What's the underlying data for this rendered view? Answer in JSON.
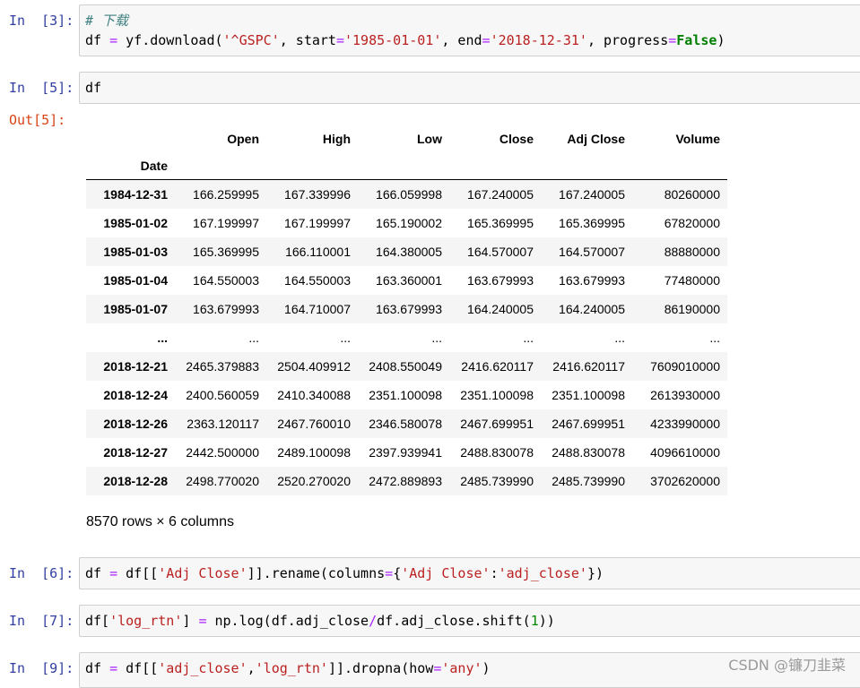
{
  "cells": [
    {
      "prompt": "In  [3]:",
      "lines": [
        [
          {
            "t": "# 下载",
            "c": "cm-comment"
          }
        ],
        [
          {
            "t": "df ",
            "c": "cm-var"
          },
          {
            "t": "=",
            "c": "cm-op"
          },
          {
            "t": " yf.download(",
            "c": "cm-var"
          },
          {
            "t": "'^GSPC'",
            "c": "cm-string"
          },
          {
            "t": ", start",
            "c": "cm-var"
          },
          {
            "t": "=",
            "c": "cm-op"
          },
          {
            "t": "'1985-01-01'",
            "c": "cm-string"
          },
          {
            "t": ", end",
            "c": "cm-var"
          },
          {
            "t": "=",
            "c": "cm-op"
          },
          {
            "t": "'2018-12-31'",
            "c": "cm-string"
          },
          {
            "t": ", progress",
            "c": "cm-var"
          },
          {
            "t": "=",
            "c": "cm-op"
          },
          {
            "t": "False",
            "c": "cm-keyword"
          },
          {
            "t": ")",
            "c": "cm-var"
          }
        ]
      ]
    },
    {
      "prompt": "In  [5]:",
      "lines": [
        [
          {
            "t": "df",
            "c": "cm-var"
          }
        ]
      ]
    },
    {
      "prompt": "In  [6]:",
      "lines": [
        [
          {
            "t": "df ",
            "c": "cm-var"
          },
          {
            "t": "=",
            "c": "cm-op"
          },
          {
            "t": " df[[",
            "c": "cm-var"
          },
          {
            "t": "'Adj Close'",
            "c": "cm-string"
          },
          {
            "t": "]].rename(columns",
            "c": "cm-var"
          },
          {
            "t": "=",
            "c": "cm-op"
          },
          {
            "t": "{",
            "c": "cm-var"
          },
          {
            "t": "'Adj Close'",
            "c": "cm-string"
          },
          {
            "t": ":",
            "c": "cm-var"
          },
          {
            "t": "'adj_close'",
            "c": "cm-string"
          },
          {
            "t": "})",
            "c": "cm-var"
          }
        ]
      ]
    },
    {
      "prompt": "In  [7]:",
      "lines": [
        [
          {
            "t": "df[",
            "c": "cm-var"
          },
          {
            "t": "'log_rtn'",
            "c": "cm-string"
          },
          {
            "t": "] ",
            "c": "cm-var"
          },
          {
            "t": "=",
            "c": "cm-op"
          },
          {
            "t": " np.log(df.adj_close",
            "c": "cm-var"
          },
          {
            "t": "/",
            "c": "cm-op"
          },
          {
            "t": "df.adj_close.shift(",
            "c": "cm-var"
          },
          {
            "t": "1",
            "c": "cm-number"
          },
          {
            "t": "))",
            "c": "cm-var"
          }
        ]
      ]
    },
    {
      "prompt": "In  [9]:",
      "lines": [
        [
          {
            "t": "df ",
            "c": "cm-var"
          },
          {
            "t": "=",
            "c": "cm-op"
          },
          {
            "t": " df[[",
            "c": "cm-var"
          },
          {
            "t": "'adj_close'",
            "c": "cm-string"
          },
          {
            "t": ",",
            "c": "cm-var"
          },
          {
            "t": "'log_rtn'",
            "c": "cm-string"
          },
          {
            "t": "]].dropna(how",
            "c": "cm-var"
          },
          {
            "t": "=",
            "c": "cm-op"
          },
          {
            "t": "'any'",
            "c": "cm-string"
          },
          {
            "t": ")",
            "c": "cm-var"
          }
        ]
      ]
    }
  ],
  "output": {
    "prompt": "Out[5]:",
    "columns": [
      "Open",
      "High",
      "Low",
      "Close",
      "Adj Close",
      "Volume"
    ],
    "index_name": "Date",
    "rows": [
      [
        "1984-12-31",
        "166.259995",
        "167.339996",
        "166.059998",
        "167.240005",
        "167.240005",
        "80260000"
      ],
      [
        "1985-01-02",
        "167.199997",
        "167.199997",
        "165.190002",
        "165.369995",
        "165.369995",
        "67820000"
      ],
      [
        "1985-01-03",
        "165.369995",
        "166.110001",
        "164.380005",
        "164.570007",
        "164.570007",
        "88880000"
      ],
      [
        "1985-01-04",
        "164.550003",
        "164.550003",
        "163.360001",
        "163.679993",
        "163.679993",
        "77480000"
      ],
      [
        "1985-01-07",
        "163.679993",
        "164.710007",
        "163.679993",
        "164.240005",
        "164.240005",
        "86190000"
      ],
      [
        "...",
        "...",
        "...",
        "...",
        "...",
        "...",
        "..."
      ],
      [
        "2018-12-21",
        "2465.379883",
        "2504.409912",
        "2408.550049",
        "2416.620117",
        "2416.620117",
        "7609010000"
      ],
      [
        "2018-12-24",
        "2400.560059",
        "2410.340088",
        "2351.100098",
        "2351.100098",
        "2351.100098",
        "2613930000"
      ],
      [
        "2018-12-26",
        "2363.120117",
        "2467.760010",
        "2346.580078",
        "2467.699951",
        "2467.699951",
        "4233990000"
      ],
      [
        "2018-12-27",
        "2442.500000",
        "2489.100098",
        "2397.939941",
        "2488.830078",
        "2488.830078",
        "4096610000"
      ],
      [
        "2018-12-28",
        "2498.770020",
        "2520.270020",
        "2472.889893",
        "2485.739990",
        "2485.739990",
        "3702620000"
      ]
    ],
    "shape_note": "8570 rows × 6 columns"
  },
  "watermark": "CSDN @镰刀韭菜",
  "colors": {
    "in_prompt": "#303f9f",
    "out_prompt": "#d84315",
    "string": "#ba2121",
    "keyword": "#008000",
    "comment": "#408080",
    "operator": "#aa22ff"
  }
}
